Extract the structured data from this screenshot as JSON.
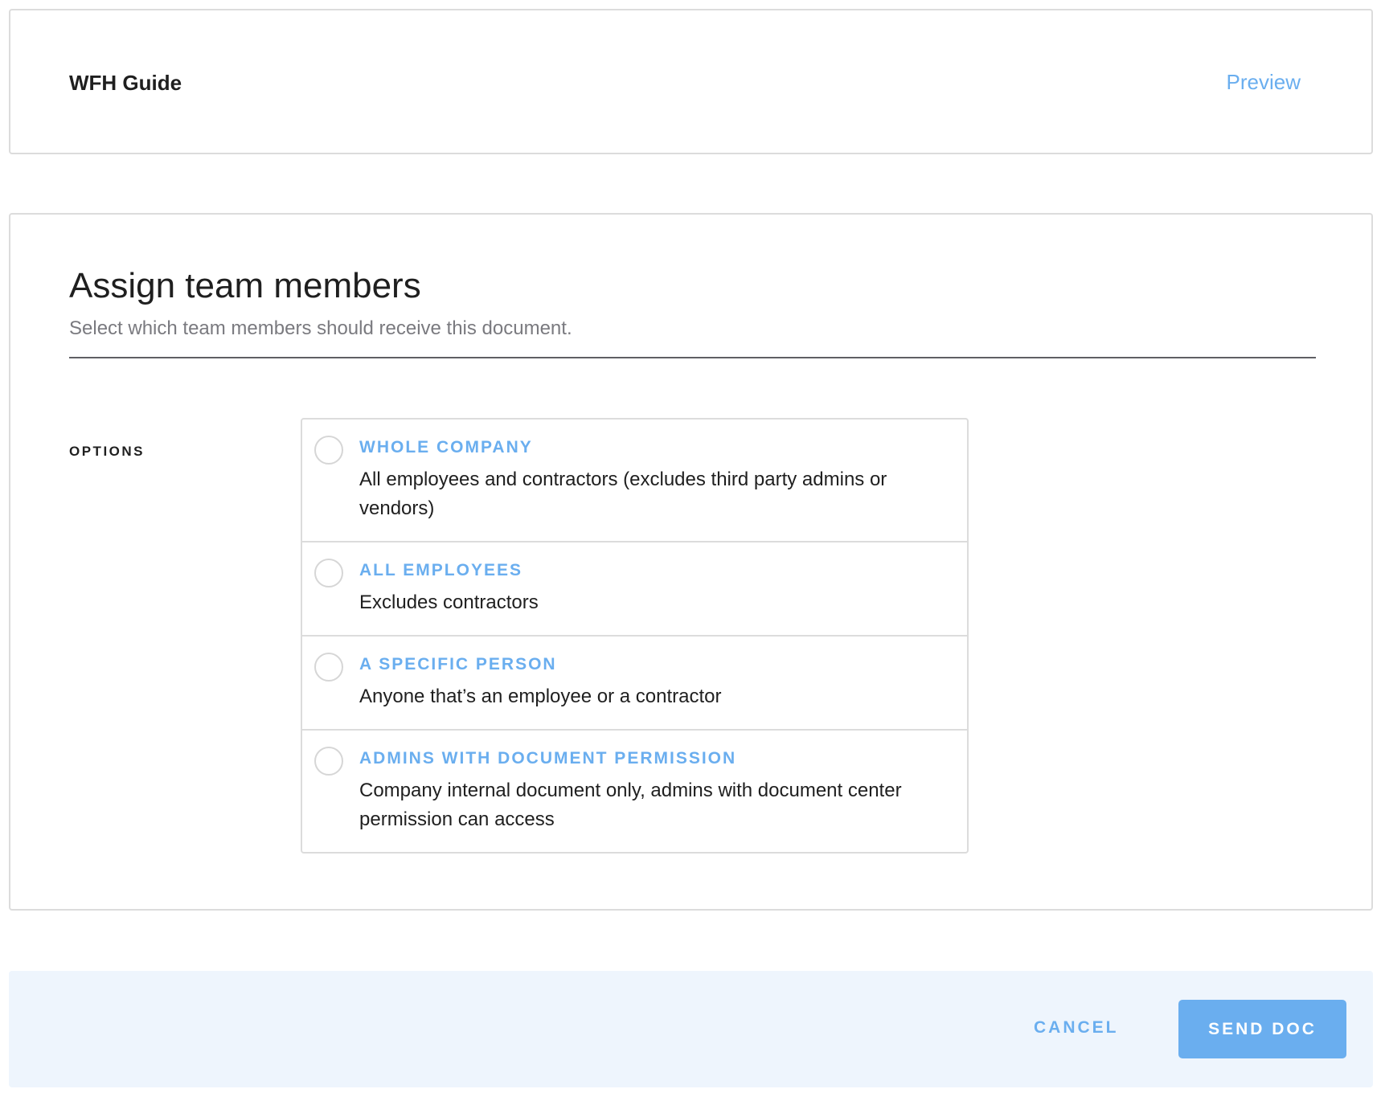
{
  "header": {
    "title": "WFH Guide",
    "preview_label": "Preview"
  },
  "assign": {
    "title": "Assign team members",
    "subtitle": "Select which team members should receive this document.",
    "options_label": "OPTIONS",
    "options": [
      {
        "title": "WHOLE COMPANY",
        "description": "All employees and contractors (excludes third party admins or vendors)",
        "selected": false
      },
      {
        "title": "ALL EMPLOYEES",
        "description": "Excludes contractors",
        "selected": false
      },
      {
        "title": "A SPECIFIC PERSON",
        "description": "Anyone that’s an employee or a contractor",
        "selected": false
      },
      {
        "title": "ADMINS WITH DOCUMENT PERMISSION",
        "description": "Company internal document only, admins with document center permission can access",
        "selected": false
      }
    ]
  },
  "footer": {
    "cancel_label": "CANCEL",
    "send_label": "SEND DOC"
  },
  "colors": {
    "accent": "#6aaeef",
    "footer_background": "#eef5fd",
    "border": "#dcdcdc",
    "text": "#1f1f1f",
    "muted_text": "#7a7a7f"
  }
}
